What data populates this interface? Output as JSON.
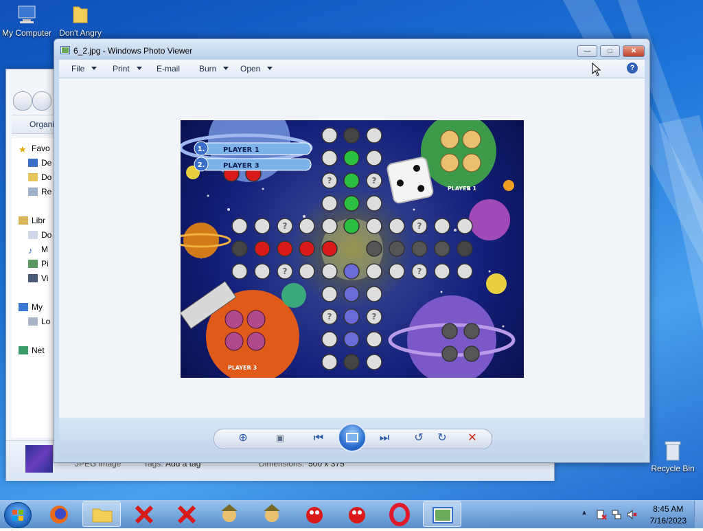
{
  "desktop": {
    "icons": [
      {
        "label": "My Computer",
        "icon": "computer-icon"
      },
      {
        "label": "Don't Angry",
        "icon": "folder-icon"
      },
      {
        "label": "Recycle Bin",
        "icon": "recycle-bin-icon"
      }
    ]
  },
  "explorer": {
    "toolbar_label": "Organize",
    "nav": [
      {
        "label": "Favo",
        "icon": "star-icon"
      },
      {
        "label": "De",
        "icon": "desktop-icon"
      },
      {
        "label": "Do",
        "icon": "folder-icon"
      },
      {
        "label": "Re",
        "icon": "recent-icon"
      },
      {
        "label": "Libr",
        "icon": "library-icon"
      },
      {
        "label": "Do",
        "icon": "documents-icon"
      },
      {
        "label": "M",
        "icon": "music-icon"
      },
      {
        "label": "Pi",
        "icon": "pictures-icon"
      },
      {
        "label": "Vi",
        "icon": "video-icon"
      },
      {
        "label": "My",
        "icon": "computer-icon"
      },
      {
        "label": "Lo",
        "icon": "drive-icon"
      },
      {
        "label": "Net",
        "icon": "network-icon"
      }
    ],
    "details": {
      "type": "JPEG image",
      "tags_label": "Tags:",
      "tags_value": "Add a tag",
      "dimensions_label": "Dimensions:",
      "dimensions_value": "500 x 375"
    }
  },
  "viewer": {
    "title": "6_2.jpg - Windows Photo Viewer",
    "window_buttons": {
      "minimize": "—",
      "maximize": "□",
      "close": "✕"
    },
    "menu": [
      {
        "label": "File",
        "dropdown": true
      },
      {
        "label": "Print",
        "dropdown": true
      },
      {
        "label": "E-mail",
        "dropdown": false
      },
      {
        "label": "Burn",
        "dropdown": true
      },
      {
        "label": "Open",
        "dropdown": true
      }
    ],
    "help": "?",
    "game": {
      "player_tags": [
        "PLAYER 1",
        "PLAYER 3"
      ],
      "player_numbers": [
        "1.",
        "2."
      ],
      "corner_labels": [
        "PLAYER 1",
        "PLAYER 3"
      ]
    },
    "controls": {
      "zoom": "⊕",
      "actual_size": "▣",
      "previous": "⏮",
      "next": "⏭",
      "rotate_ccw": "↺",
      "rotate_cw": "↻",
      "delete": "✕"
    }
  },
  "taskbar": {
    "time": "8:45 AM",
    "date": "7/16/2023",
    "apps": [
      "start-button",
      "firefox",
      "explorer",
      "x-app-1",
      "x-app-2",
      "game-1",
      "game-2",
      "ladybug-1",
      "ladybug-2",
      "opera",
      "photo-viewer"
    ]
  }
}
